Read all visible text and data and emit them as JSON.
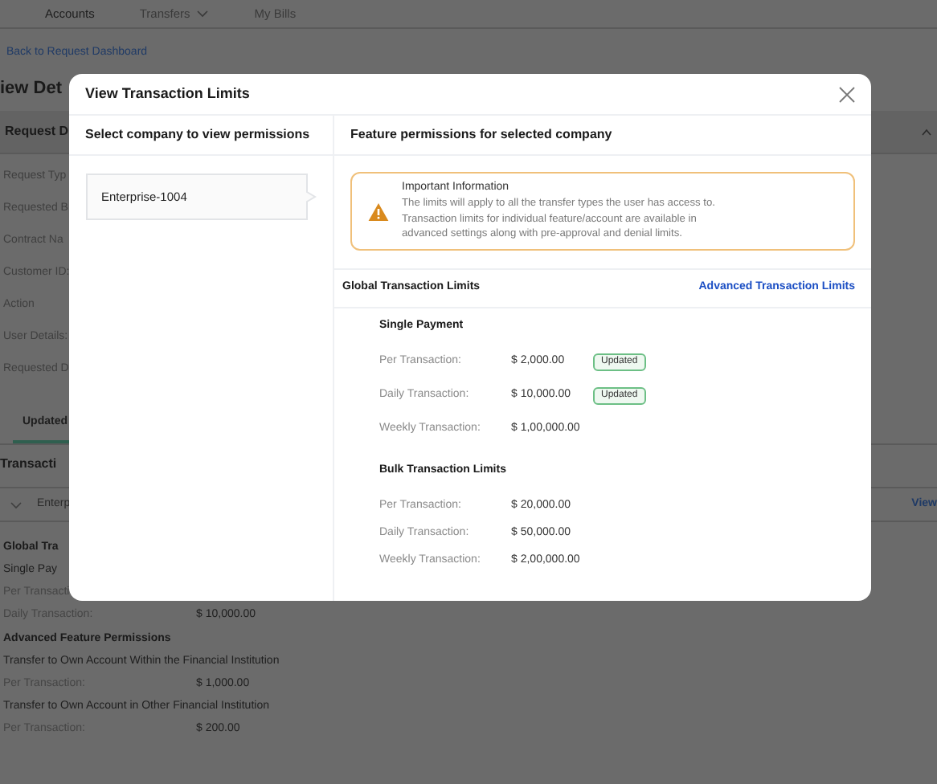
{
  "nav": {
    "items": [
      {
        "label": "Accounts",
        "selected": true,
        "dropdown": false
      },
      {
        "label": "Transfers",
        "selected": false,
        "dropdown": true
      },
      {
        "label": "My Bills",
        "selected": false,
        "dropdown": false
      }
    ]
  },
  "back_link": "Back to Request Dashboard",
  "page_title": "iew Det",
  "request_panel": {
    "title": "Request D",
    "fields": [
      "Request Typ",
      "Requested B",
      "Contract Na",
      "Customer ID:",
      "Action",
      "User Details:",
      "Requested D"
    ]
  },
  "tabs": [
    {
      "label": "Updated",
      "selected": true
    }
  ],
  "transactions": {
    "title": "Transacti",
    "company": "Enterp",
    "view_link": "View",
    "lines": [
      {
        "kind": "heading",
        "text": "Global Tra"
      },
      {
        "kind": "subheading",
        "text": "Single Pay"
      },
      {
        "kind": "row",
        "label": "Per Transacti"
      },
      {
        "kind": "row",
        "label": "Daily Transaction:",
        "value": "$ 10,000.00"
      },
      {
        "kind": "heading",
        "text": "Advanced Feature Permissions"
      },
      {
        "kind": "subheading",
        "text": "Transfer to Own Account Within the Financial Institution"
      },
      {
        "kind": "row",
        "label": "Per Transaction:",
        "value": "$ 1,000.00"
      },
      {
        "kind": "subheading",
        "text": "Transfer to Own Account in Other Financial Institution"
      },
      {
        "kind": "row",
        "label": "Per Transaction:",
        "value": "$ 200.00"
      }
    ]
  },
  "modal": {
    "title": "View Transaction Limits",
    "left_heading": "Select company to view permissions",
    "companies": [
      {
        "name": "Enterprise-1004",
        "selected": true
      }
    ],
    "right_heading": "Feature permissions for selected company",
    "info": {
      "title": "Important Information",
      "text": "The limits will apply to all the transfer types the user has access to.\nTransaction limits for individual feature/account are available in\nadvanced settings along with pre-approval and denial limits."
    },
    "global_title": "Global Transaction Limits",
    "advanced_link": "Advanced Transaction Limits",
    "groups": [
      {
        "title": "Single Payment",
        "rows": [
          {
            "label": "Per Transaction:",
            "value": "$ 2,000.00",
            "badge": "Updated"
          },
          {
            "label": "Daily Transaction:",
            "value": "$ 10,000.00",
            "badge": "Updated"
          },
          {
            "label": "Weekly Transaction:",
            "value": "$ 1,00,000.00"
          }
        ]
      },
      {
        "title": "Bulk Transaction Limits",
        "rows": [
          {
            "label": "Per Transaction:",
            "value": "$ 20,000.00"
          },
          {
            "label": "Daily Transaction:",
            "value": "$ 50,000.00"
          },
          {
            "label": "Weekly Transaction:",
            "value": "$ 2,00,000.00"
          }
        ]
      }
    ]
  }
}
